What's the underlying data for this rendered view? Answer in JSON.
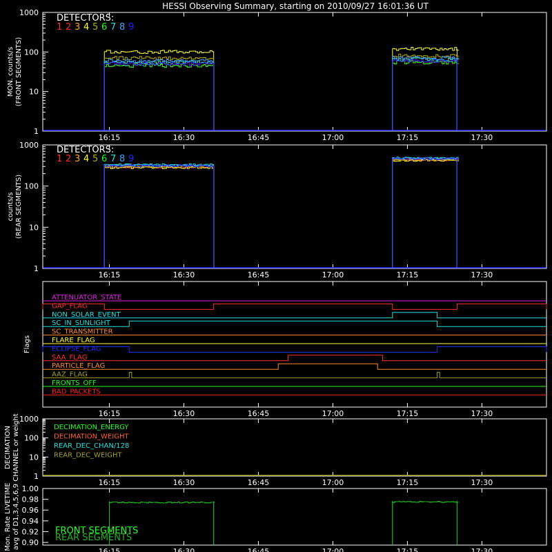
{
  "title": "HESSI Observing Summary, starting on 2010/09/27 16:01:36 UT",
  "time_ticks": [
    "16:15",
    "16:30",
    "16:45",
    "17:00",
    "17:15",
    "17:30"
  ],
  "detector_colors": [
    "#ff3030",
    "#ff2a2a",
    "#ffa500",
    "#ffff40",
    "#b8b000",
    "#20ff20",
    "#20e0e0",
    "#40a0ff",
    "#2020ff"
  ],
  "chart_data": [
    {
      "type": "line",
      "title": "HESSI Observing Summary, starting on 2010/09/27 16:01:36 UT",
      "ylabel": "MON. counts/s",
      "ylabel2": "(FRONT SEGMENTS)",
      "yscale": "log",
      "ylim": [
        1,
        1000
      ],
      "yticks": [
        "1",
        "10",
        "100",
        "1000"
      ],
      "xticks": [
        "16:15",
        "16:30",
        "16:45",
        "17:00",
        "17:15",
        "17:30"
      ],
      "legend_title": "DETECTORS:",
      "legend_labels": [
        "1",
        "2",
        "3",
        "4",
        "5",
        "6",
        "7",
        "8",
        "9"
      ],
      "intervals": [
        [
          "16:14",
          "16:36"
        ],
        [
          "17:12",
          "17:25"
        ]
      ],
      "series": [
        {
          "name": "1",
          "values": [
            45,
            55
          ]
        },
        {
          "name": "2",
          "values": [
            50,
            60
          ]
        },
        {
          "name": "3",
          "values": [
            55,
            65
          ]
        },
        {
          "name": "4",
          "values": [
            100,
            120
          ]
        },
        {
          "name": "5",
          "values": [
            70,
            80
          ]
        },
        {
          "name": "6",
          "values": [
            45,
            55
          ]
        },
        {
          "name": "7",
          "values": [
            55,
            65
          ]
        },
        {
          "name": "8",
          "values": [
            60,
            70
          ]
        },
        {
          "name": "9",
          "values": [
            50,
            60
          ]
        }
      ]
    },
    {
      "type": "line",
      "ylabel": "counts/s",
      "ylabel2": "(REAR SEGMENTS)",
      "yscale": "log",
      "ylim": [
        1,
        1000
      ],
      "yticks": [
        "1",
        "10",
        "100",
        "1000"
      ],
      "xticks": [
        "16:15",
        "16:30",
        "16:45",
        "17:00",
        "17:15",
        "17:30"
      ],
      "legend_title": "DETECTORS:",
      "legend_labels": [
        "1",
        "2",
        "3",
        "4",
        "5",
        "6",
        "7",
        "8",
        "9"
      ],
      "intervals": [
        [
          "16:14",
          "16:36"
        ],
        [
          "17:12",
          "17:25"
        ]
      ],
      "series": [
        {
          "name": "1",
          "values": [
            300,
            450
          ]
        },
        {
          "name": "2",
          "values": [
            290,
            430
          ]
        },
        {
          "name": "3",
          "values": [
            310,
            460
          ]
        },
        {
          "name": "4",
          "values": [
            280,
            420
          ]
        },
        {
          "name": "5",
          "values": [
            300,
            440
          ]
        },
        {
          "name": "6",
          "values": [
            320,
            470
          ]
        },
        {
          "name": "7",
          "values": [
            330,
            480
          ]
        },
        {
          "name": "8",
          "values": [
            320,
            470
          ]
        },
        {
          "name": "9",
          "values": [
            310,
            460
          ]
        }
      ]
    },
    {
      "type": "line",
      "ylabel": "Flags",
      "xticks": [
        "16:15",
        "16:30",
        "16:45",
        "17:00",
        "17:15",
        "17:30"
      ],
      "flags": [
        {
          "name": "ATTENUATOR_STATE",
          "color": "#e020e0",
          "on": []
        },
        {
          "name": "GAP_FLAG",
          "color": "#ff3030",
          "on": [
            [
              "16:01:36",
              "16:14"
            ],
            [
              "16:36",
              "17:12"
            ],
            [
              "17:25",
              "17:43"
            ]
          ]
        },
        {
          "name": "NON_SOLAR_EVENT",
          "color": "#20e0e0",
          "on": [
            [
              "17:12",
              "17:21"
            ]
          ]
        },
        {
          "name": "SC_IN_SUNLIGHT",
          "color": "#20e0e0",
          "on": [
            [
              "16:19",
              "17:21"
            ]
          ]
        },
        {
          "name": "SC_TRANSMITTER",
          "color": "#ff8c30",
          "on": []
        },
        {
          "name": "FLARE_FLAG",
          "color": "#ffff40",
          "on": []
        },
        {
          "name": "ECLIPSE_FLAG",
          "color": "#2030ff",
          "on": [
            [
              "16:01:36",
              "16:19"
            ],
            [
              "17:21",
              "17:43"
            ]
          ]
        },
        {
          "name": "SAA_FLAG",
          "color": "#ff3030",
          "on": [
            [
              "16:51",
              "17:10"
            ]
          ]
        },
        {
          "name": "PARTICLE_FLAG",
          "color": "#ff8c30",
          "on": [
            [
              "16:49",
              "17:09"
            ]
          ]
        },
        {
          "name": "AAZ_FLAG",
          "color": "#a0a020",
          "on": [
            [
              "16:19",
              "16:19:30"
            ],
            [
              "17:21",
              "17:21:30"
            ]
          ]
        },
        {
          "name": "FRONTS_OFF",
          "color": "#20ff20",
          "on": []
        },
        {
          "name": "BAD_PACKETS",
          "color": "#ff2020",
          "on": []
        }
      ]
    },
    {
      "type": "line",
      "ylabel": "DECIMATION",
      "ylabel2": "CHANNEL or weight",
      "yscale": "log",
      "ylim": [
        1,
        1000
      ],
      "yticks": [
        "1",
        "10",
        "100",
        "1000"
      ],
      "xticks": [
        "16:15",
        "16:30",
        "16:45",
        "17:00",
        "17:15",
        "17:30"
      ],
      "series": [
        {
          "name": "DECIMATION_ENERGY",
          "color": "#20ff20",
          "values": []
        },
        {
          "name": "DECIMATION_WEIGHT",
          "color": "#ff6030",
          "values": []
        },
        {
          "name": "REAR_DEC_CHAN/128",
          "color": "#20e0e0",
          "values": []
        },
        {
          "name": "REAR_DEC_WEIGHT",
          "color": "#a0a020",
          "values": [
            1
          ]
        }
      ]
    },
    {
      "type": "line",
      "ylabel": "Mon. Rate LIVETIME",
      "ylabel2": "avg of D1,3,4,5,6,9",
      "ylim": [
        0.895,
        1.0
      ],
      "yticks": [
        "0.90",
        "0.92",
        "0.94",
        "0.96",
        "0.98",
        "1.00"
      ],
      "intervals": [
        [
          "16:15",
          "16:36"
        ],
        [
          "17:12",
          "17:25"
        ]
      ],
      "series": [
        {
          "name": "FRONT SEGMENTS",
          "color": "#20ff20",
          "values": [
            0.976,
            0.977
          ]
        },
        {
          "name": "REAR SEGMENTS",
          "color": "#20b020",
          "values": [
            0.976,
            0.977
          ]
        }
      ]
    }
  ]
}
